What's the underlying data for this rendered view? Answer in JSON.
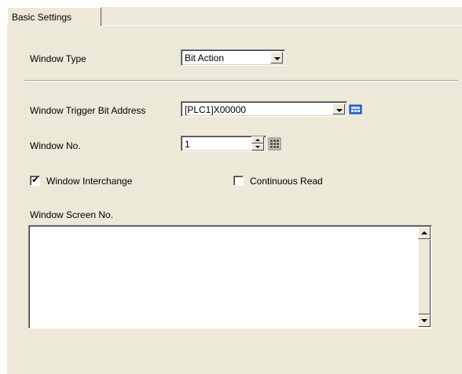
{
  "tab": {
    "label": "Basic Settings"
  },
  "window_type": {
    "label": "Window Type",
    "value": "Bit Action"
  },
  "trigger": {
    "label": "Window Trigger Bit Address",
    "value": "[PLC1]X00000"
  },
  "window_no": {
    "label": "Window No.",
    "value": "1"
  },
  "interchange": {
    "label": "Window Interchange",
    "checked": true
  },
  "continuous_read": {
    "label": "Continuous Read",
    "checked": false
  },
  "screen_no": {
    "label": "Window Screen No.",
    "value": ""
  },
  "icons": {
    "address_input": "address-keypad-icon",
    "number_input": "numeric-keypad-icon"
  }
}
